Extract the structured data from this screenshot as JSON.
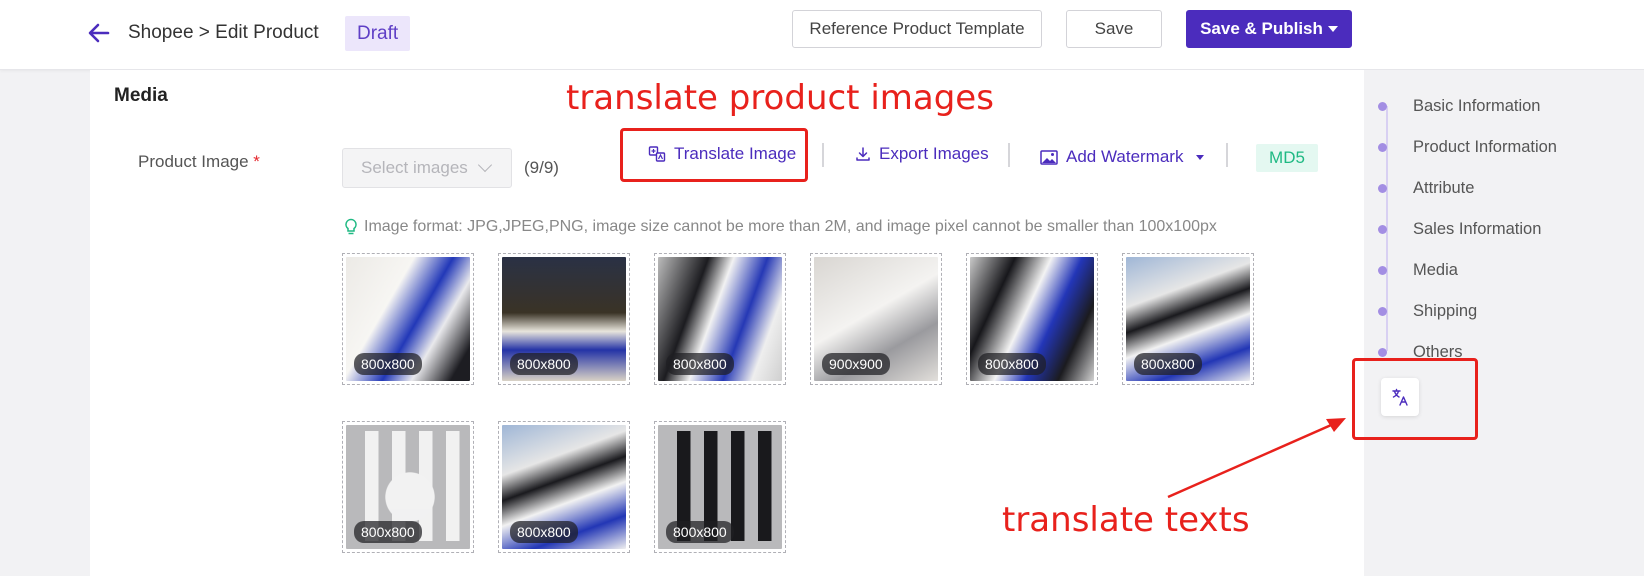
{
  "header": {
    "breadcrumb": "Shopee > Edit Product",
    "status_badge": "Draft",
    "reference_button": "Reference Product Template",
    "save_button": "Save",
    "publish_button": "Save & Publish"
  },
  "media": {
    "section_title": "Media",
    "field_label": "Product Image",
    "required_mark": "*",
    "select_placeholder": "Select images",
    "count": "(9/9)",
    "translate_image": "Translate Image",
    "export_images": "Export Images",
    "add_watermark": "Add Watermark",
    "md5": "MD5",
    "hint": "Image format: JPG,JPEG,PNG, image size cannot be more than 2M, and image pixel cannot be smaller than 100x100px",
    "images": [
      {
        "size": "800x800"
      },
      {
        "size": "800x800"
      },
      {
        "size": "800x800"
      },
      {
        "size": "900x900"
      },
      {
        "size": "800x800"
      },
      {
        "size": "800x800"
      },
      {
        "size": "800x800"
      },
      {
        "size": "800x800"
      },
      {
        "size": "800x800"
      }
    ]
  },
  "side_nav": {
    "items": [
      {
        "label": "Basic Information"
      },
      {
        "label": "Product Information"
      },
      {
        "label": "Attribute"
      },
      {
        "label": "Sales Information"
      },
      {
        "label": "Media"
      },
      {
        "label": "Shipping"
      },
      {
        "label": "Others"
      }
    ]
  },
  "annotations": {
    "top": "translate product images",
    "bottom": "translate texts"
  },
  "colors": {
    "accent": "#4b2cbd",
    "annotation": "#e8211c",
    "md5": "#1fb983"
  }
}
